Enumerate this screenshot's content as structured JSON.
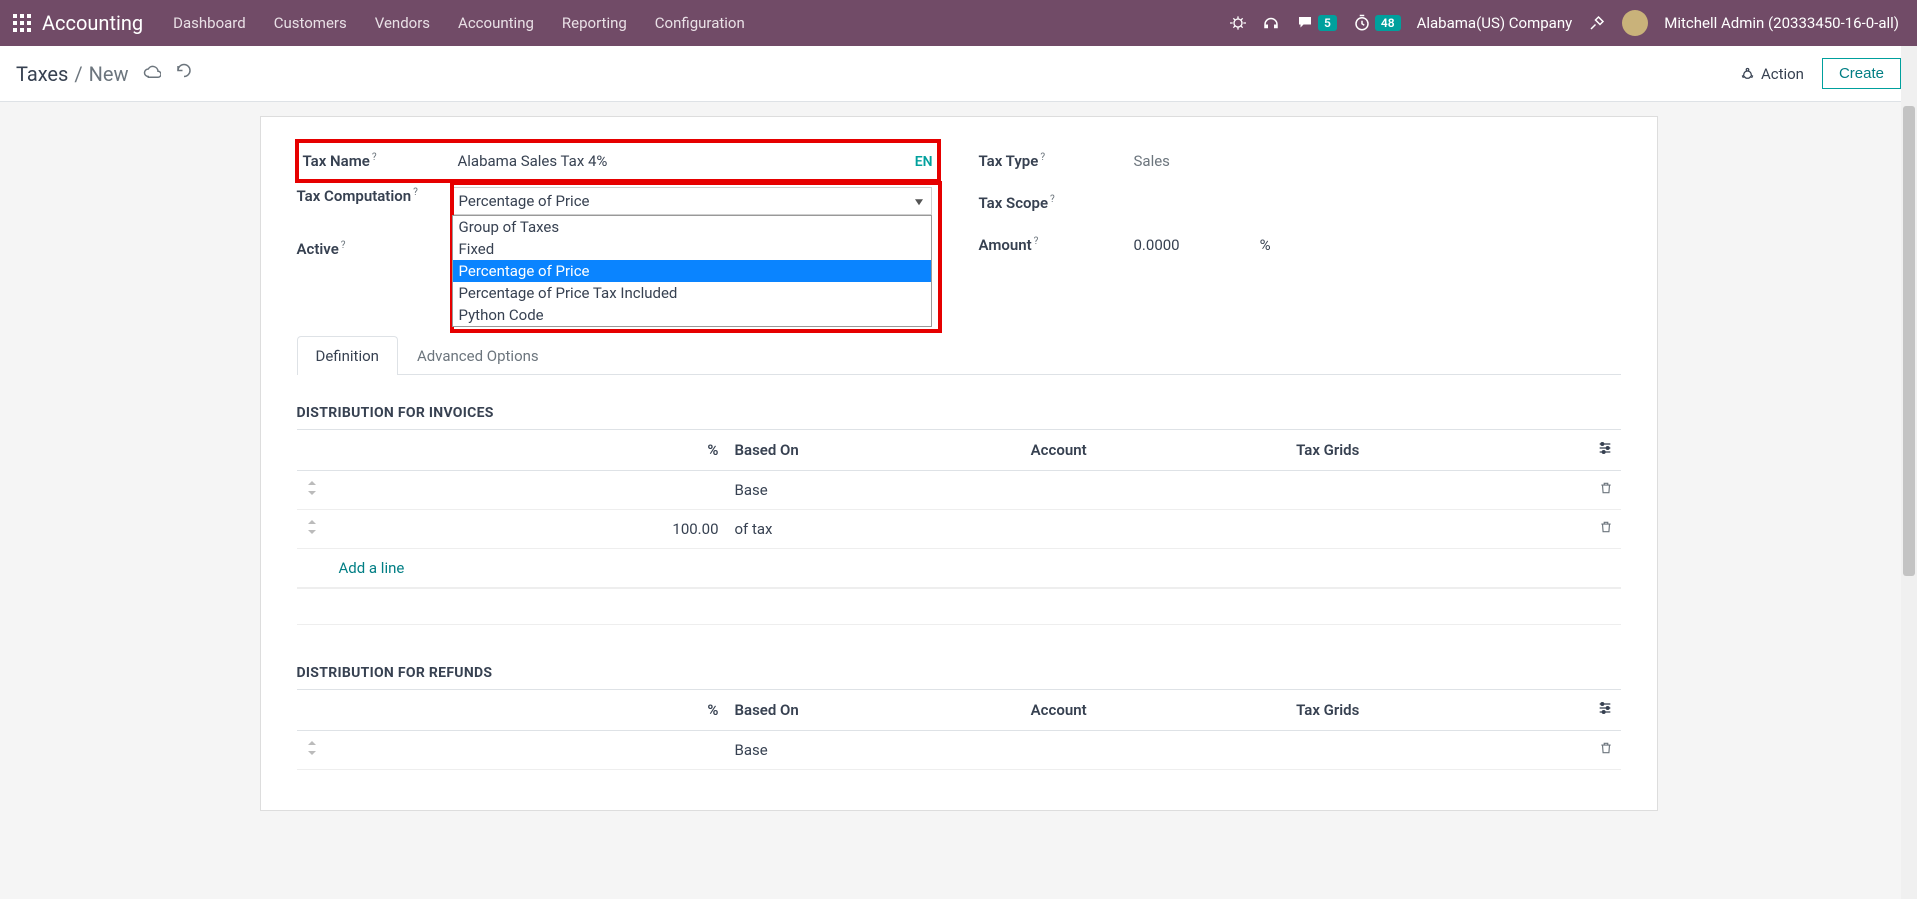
{
  "navbar": {
    "app": "Accounting",
    "links": [
      "Dashboard",
      "Customers",
      "Vendors",
      "Accounting",
      "Reporting",
      "Configuration"
    ],
    "msg_count": "5",
    "timer_count": "48",
    "company": "Alabama(US) Company",
    "user": "Mitchell Admin (20333450-16-0-all)"
  },
  "breadcrumb": {
    "root": "Taxes",
    "sep": "/",
    "current": "New"
  },
  "actions": {
    "action_label": "Action",
    "create_label": "Create"
  },
  "fields": {
    "tax_name_label": "Tax Name",
    "tax_name_value": "Alabama Sales Tax 4%",
    "lang": "EN",
    "tax_type_label": "Tax Type",
    "tax_type_value": "Sales",
    "tax_comp_label": "Tax Computation",
    "tax_comp_value": "Percentage of Price",
    "tax_comp_options": [
      "Group of Taxes",
      "Fixed",
      "Percentage of Price",
      "Percentage of Price Tax Included",
      "Python Code"
    ],
    "tax_scope_label": "Tax Scope",
    "active_label": "Active",
    "amount_label": "Amount",
    "amount_value": "0.0000",
    "amount_unit": "%"
  },
  "tabs": {
    "definition": "Definition",
    "advanced": "Advanced Options"
  },
  "dist_invoices": {
    "title": "DISTRIBUTION FOR INVOICES",
    "cols": {
      "pct": "%",
      "based_on": "Based On",
      "account": "Account",
      "tax_grids": "Tax Grids"
    },
    "rows": [
      {
        "pct": "",
        "based_on": "Base"
      },
      {
        "pct": "100.00",
        "based_on": "of tax"
      }
    ],
    "add_line": "Add a line"
  },
  "dist_refunds": {
    "title": "DISTRIBUTION FOR REFUNDS",
    "cols": {
      "pct": "%",
      "based_on": "Based On",
      "account": "Account",
      "tax_grids": "Tax Grids"
    },
    "rows": [
      {
        "pct": "",
        "based_on": "Base"
      }
    ]
  }
}
